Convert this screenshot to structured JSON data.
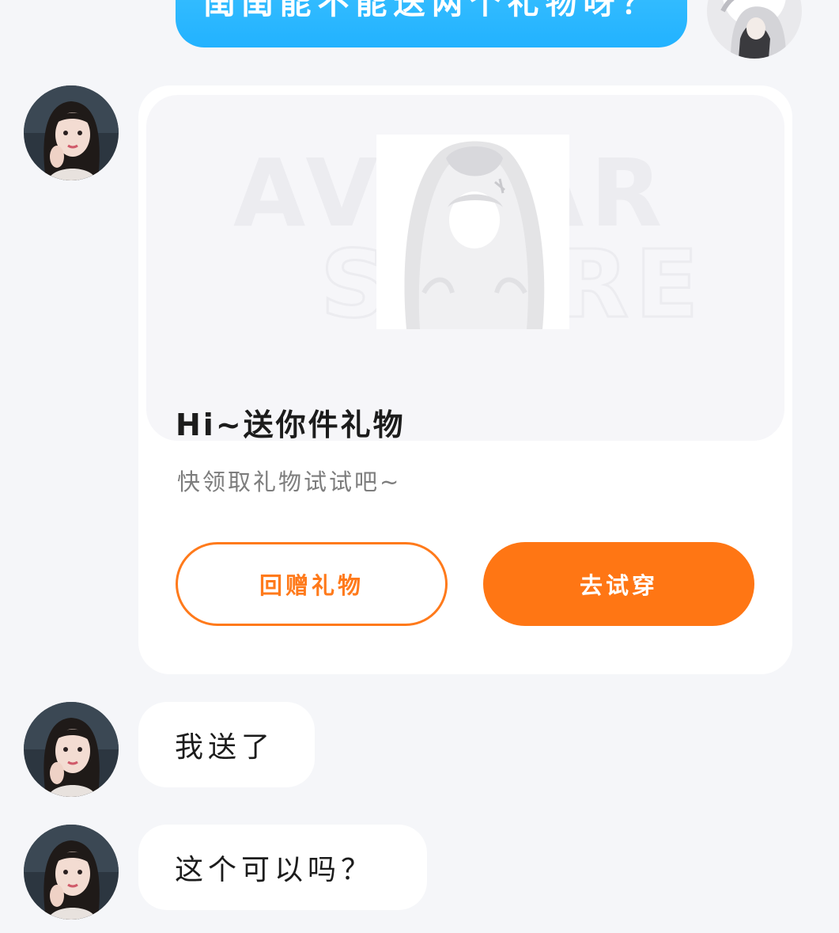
{
  "conversation": {
    "outgoing_top": {
      "text": "闺闺能不能送两个礼物呀？"
    },
    "gift_card": {
      "banner_watermark": "AVATAR SHARE",
      "title": "Hi~送你件礼物",
      "subtitle": "快领取礼物试试吧~",
      "return_gift_label": "回赠礼物",
      "try_on_label": "去试穿"
    },
    "incoming_messages": [
      {
        "text": "我送了"
      },
      {
        "text": "这个可以吗？"
      }
    ]
  },
  "colors": {
    "background": "#f5f6f9",
    "outgoing_bubble": "#2bb8ff",
    "accent_orange": "#ff7614",
    "card_bg": "#ffffff",
    "banner_bg": "#f6f6f9",
    "title_text": "#1c1c1c",
    "subtitle_text": "#7d7d7d"
  }
}
